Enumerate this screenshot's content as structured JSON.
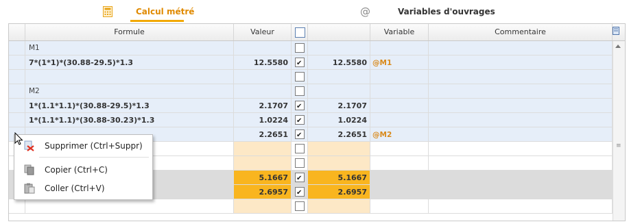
{
  "tabs": [
    {
      "label": "Calcul métré",
      "icon": "calculator-icon",
      "active": true
    },
    {
      "label": "Variables d'ouvrages",
      "icon": "at-icon",
      "active": false
    }
  ],
  "grid": {
    "headers": {
      "formule": "Formule",
      "valeur": "Valeur",
      "variable": "Variable",
      "commentaire": "Commentaire"
    },
    "rows": [
      {
        "formule": "M1",
        "valeur": "",
        "checked": false,
        "var_valeur": "",
        "tag": "",
        "style": "blue",
        "group": true,
        "selected": true
      },
      {
        "formule": "7*(1*1)*(30.88-29.5)*1.3",
        "valeur": "12.5580",
        "checked": true,
        "var_valeur": "12.5580",
        "tag": "@M1",
        "style": "blue"
      },
      {
        "formule": "",
        "valeur": "",
        "checked": false,
        "var_valeur": "",
        "tag": "",
        "style": "blue"
      },
      {
        "formule": "M2",
        "valeur": "",
        "checked": false,
        "var_valeur": "",
        "tag": "",
        "style": "blue",
        "group": true
      },
      {
        "formule": "1*(1.1*1.1)*(30.88-29.5)*1.3",
        "valeur": "2.1707",
        "checked": true,
        "var_valeur": "2.1707",
        "tag": "",
        "style": "blue"
      },
      {
        "formule": "1*(1.1*1.1)*(30.88-30.23)*1.3",
        "valeur": "1.0224",
        "checked": true,
        "var_valeur": "1.0224",
        "tag": "",
        "style": "blue"
      },
      {
        "formule": "",
        "valeur": "2.2651",
        "checked": true,
        "var_valeur": "2.2651",
        "tag": "@M2",
        "style": "blue"
      },
      {
        "formule": "",
        "valeur": "",
        "checked": false,
        "var_valeur": "",
        "tag": "",
        "style": "white"
      },
      {
        "formule": "",
        "valeur": "",
        "checked": false,
        "var_valeur": "",
        "tag": "",
        "style": "white"
      },
      {
        "formule": "",
        "valeur": "5.1667",
        "checked": true,
        "var_valeur": "5.1667",
        "tag": "",
        "style": "gray"
      },
      {
        "formule": "",
        "valeur": "2.6957",
        "checked": true,
        "var_valeur": "2.6957",
        "tag": "",
        "style": "gray"
      },
      {
        "formule": "",
        "valeur": "",
        "checked": false,
        "var_valeur": "",
        "tag": "",
        "style": "white"
      }
    ]
  },
  "context_menu": {
    "items": [
      {
        "label": "Supprimer (Ctrl+Suppr)",
        "icon": "delete-icon"
      },
      {
        "label": "Copier (Ctrl+C)",
        "icon": "copy-icon"
      },
      {
        "label": "Coller (Ctrl+V)",
        "icon": "paste-icon"
      }
    ]
  },
  "colors": {
    "accent": "#f2a900",
    "row_blue": "#e6eef9",
    "value_orange": "#f9b51f",
    "value_light": "#fde8c6",
    "tag": "#d98a1c"
  }
}
